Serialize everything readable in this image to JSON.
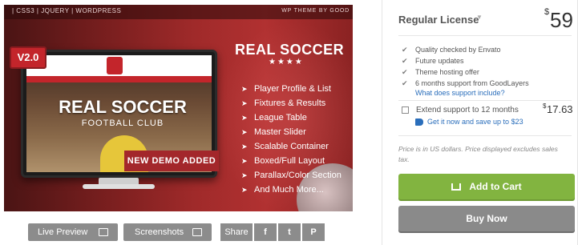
{
  "banner": {
    "top_left": "| CSS3 | JQUERY | WORDPRESS",
    "top_right": "WP THEME BY GOOD",
    "version_badge": "V2.0",
    "screen_title": "REAL SOCCER",
    "screen_subtitle": "FOOTBALL CLUB",
    "demo_tag": "NEW DEMO ADDED",
    "product_title": "REAL SOCCER",
    "stars": "★★★★",
    "features": [
      "Player Profile & List",
      "Fixtures & Results",
      "League Table",
      "Master Slider",
      "Scalable Container",
      "Boxed/Full Layout",
      "Parallax/Color Section",
      "And Much More..."
    ]
  },
  "actions": {
    "live_preview": "Live Preview",
    "screenshots": "Screenshots",
    "share": "Share",
    "facebook": "f",
    "twitter": "t",
    "pinterest": "P"
  },
  "pricing": {
    "license": "Regular License",
    "currency": "$",
    "price": "59",
    "checks": [
      "Quality checked by Envato",
      "Future updates",
      "Theme hosting offer",
      "6 months support from GoodLayers"
    ],
    "support_link": "What does support include?",
    "extend_label": "Extend support to 12 months",
    "extend_price": "17.63",
    "extend_offer": "Get it now and save up to $23",
    "note": "Price is in US dollars. Price displayed excludes sales tax.",
    "add_to_cart": "Add to Cart",
    "buy_now": "Buy Now"
  },
  "colors": {
    "accent_green": "#82b440",
    "link_blue": "#2a6ebb",
    "banner_red": "#a3272b",
    "button_gray": "#8c8c8c"
  }
}
